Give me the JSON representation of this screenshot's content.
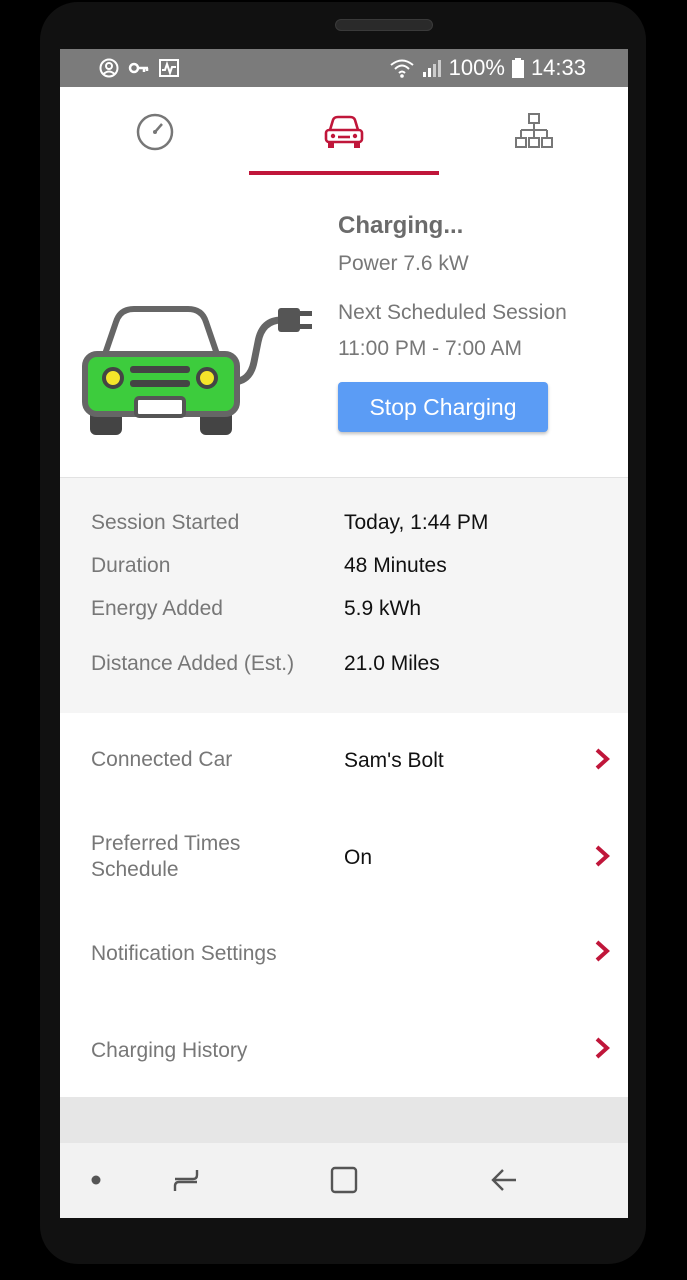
{
  "status_bar": {
    "battery": "100%",
    "time": "14:33",
    "left_icons": [
      "account-circle-icon",
      "key-icon",
      "activity-icon"
    ],
    "right_icons": [
      "wifi-icon",
      "signal-icon",
      "battery-icon"
    ]
  },
  "tabs": [
    {
      "icon": "gauge-icon",
      "active": false
    },
    {
      "icon": "car-icon",
      "active": true
    },
    {
      "icon": "network-icon",
      "active": false
    }
  ],
  "colors": {
    "accent": "#c0163a",
    "button": "#5b9cf5",
    "car_body": "#3dcc3d"
  },
  "charging": {
    "status": "Charging...",
    "power": "Power 7.6 kW",
    "next_label": "Next Scheduled Session",
    "next_time": "11:00 PM - 7:00 AM",
    "stop_button": "Stop Charging"
  },
  "session": {
    "rows": [
      {
        "label": "Session Started",
        "value": "Today, 1:44 PM"
      },
      {
        "label": "Duration",
        "value": "48 Minutes"
      },
      {
        "label": "Energy Added",
        "value": "5.9 kWh"
      },
      {
        "label": "Distance Added (Est.)",
        "value": "21.0 Miles"
      }
    ]
  },
  "menu": {
    "connected_car": {
      "label": "Connected Car",
      "value": "Sam's Bolt"
    },
    "preferred_times": {
      "label_line1": "Preferred Times",
      "label_line2": "Schedule",
      "value": "On"
    },
    "notification_settings": {
      "label": "Notification Settings"
    },
    "charging_history": {
      "label": "Charging History"
    }
  },
  "nav_bar": [
    "dot-icon",
    "recents-icon",
    "home-icon",
    "back-icon"
  ]
}
